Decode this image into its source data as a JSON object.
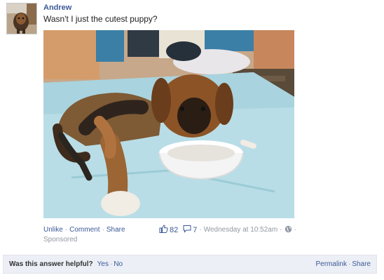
{
  "post": {
    "author": "Andrew",
    "message": "Wasn't I just the cutest puppy?",
    "photo_alt": "puppy-photo"
  },
  "actions": {
    "unlike": "Unlike",
    "comment": "Comment",
    "share": "Share",
    "sponsored": "Sponsored"
  },
  "meta": {
    "likes": "82",
    "comments": "7",
    "timestamp": "Wednesday at 10:52am",
    "dot": "·"
  },
  "helpbar": {
    "question": "Was this answer helpful?",
    "yes": "Yes",
    "no": "No",
    "permalink": "Permalink",
    "share": "Share"
  },
  "icons": {
    "like": "thumbs-up-icon",
    "comment": "speech-bubble-icon",
    "privacy": "globe-icon"
  },
  "colors": {
    "link": "#3b5998",
    "muted": "#9197a3",
    "bar_bg": "#eceff5"
  }
}
